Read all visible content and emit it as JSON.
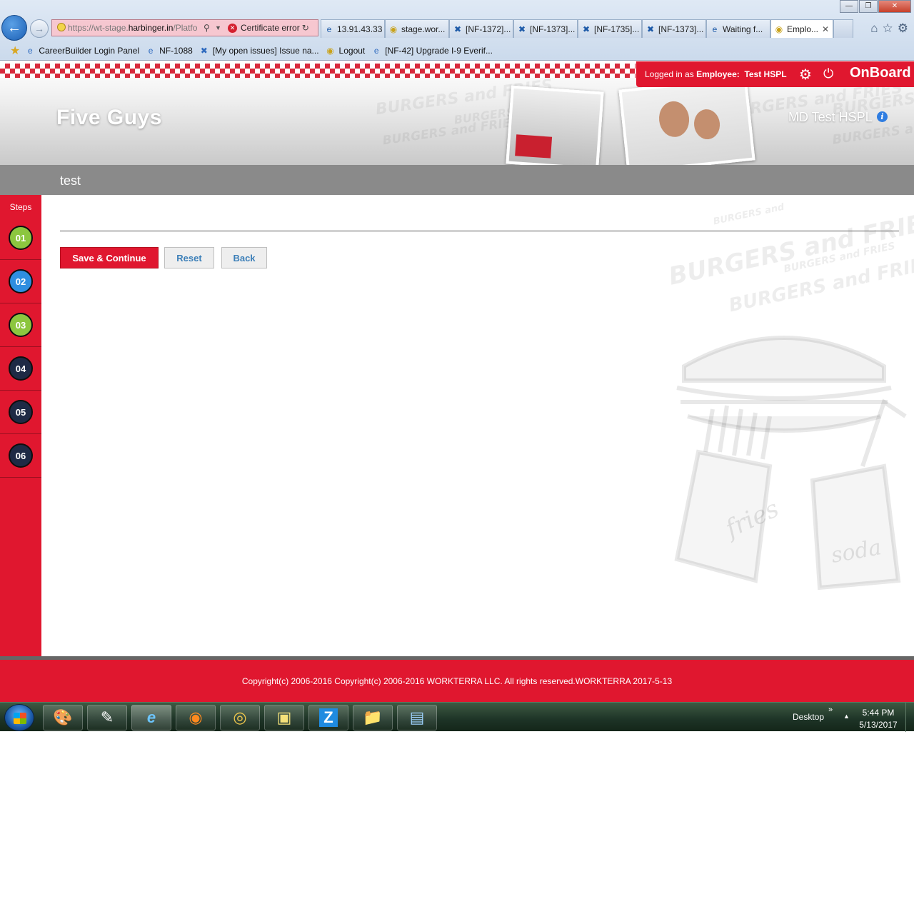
{
  "browser": {
    "url_prefix": "https://wt-stage.",
    "url_host": "harbinger.in",
    "url_suffix": "/Platfo",
    "cert_error": "Certificate error",
    "tabs": [
      {
        "label": "13.91.43.33",
        "icon": "ie-icon"
      },
      {
        "label": "stage.wor...",
        "icon": "site-icon"
      },
      {
        "label": "[NF-1372]...",
        "icon": "jira-icon"
      },
      {
        "label": "[NF-1373]...",
        "icon": "jira-icon"
      },
      {
        "label": "[NF-1735]...",
        "icon": "jira-icon"
      },
      {
        "label": "[NF-1373]...",
        "icon": "jira-icon"
      },
      {
        "label": "Waiting f...",
        "icon": "ie-icon"
      },
      {
        "label": "Emplo...",
        "icon": "site-icon",
        "active": true
      }
    ],
    "favorites": [
      {
        "label": "CareerBuilder Login Panel",
        "icon": "ie-icon"
      },
      {
        "label": "NF-1088",
        "icon": "ie-icon"
      },
      {
        "label": "[My open issues] Issue na...",
        "icon": "jira-icon"
      },
      {
        "label": "Logout",
        "icon": "site-icon"
      },
      {
        "label": "[NF-42] Upgrade I-9 Everif...",
        "icon": "ie-icon"
      }
    ]
  },
  "header": {
    "brand": "Five Guys",
    "user_display": "MD Test HSPL",
    "login_prefix": "Logged in as",
    "login_role": "Employee:",
    "login_name": "Test HSPL",
    "product": "OnBoard",
    "page_title": "test"
  },
  "sidebar": {
    "label": "Steps",
    "steps": [
      {
        "number": "01",
        "state": "done"
      },
      {
        "number": "02",
        "state": "current"
      },
      {
        "number": "03",
        "state": "done"
      },
      {
        "number": "04",
        "state": "todo"
      },
      {
        "number": "05",
        "state": "todo"
      },
      {
        "number": "06",
        "state": "todo"
      }
    ]
  },
  "form": {
    "save_label": "Save & Continue",
    "reset_label": "Reset",
    "back_label": "Back"
  },
  "footer": {
    "copyright": "Copyright(c) 2006-2016 Copyright(c) 2006-2016 WORKTERRA LLC. All rights reserved.WORKTERRA 2017-5-13"
  },
  "taskbar": {
    "desktop_label": "Desktop",
    "time": "5:44 PM",
    "date": "5/13/2017"
  },
  "colors": {
    "brand_red": "#e0172f",
    "step_done": "#8cc63f",
    "step_current": "#2f8ee0",
    "step_todo": "#1e2a45"
  }
}
